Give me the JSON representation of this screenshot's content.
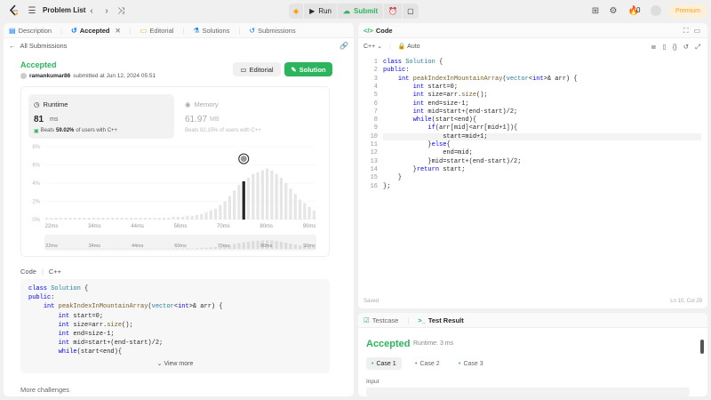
{
  "topbar": {
    "title": "Problem List",
    "run_label": "Run",
    "submit_label": "Submit",
    "fire_count": "0",
    "premium_label": "Premium"
  },
  "left_tabs": [
    {
      "label": "Description",
      "active": false
    },
    {
      "label": "Accepted",
      "active": true
    },
    {
      "label": "Editorial",
      "active": false
    },
    {
      "label": "Solutions",
      "active": false
    },
    {
      "label": "Submissions",
      "active": false
    }
  ],
  "submission": {
    "back_label": "All Submissions",
    "status": "Accepted",
    "user": "ramankumar86",
    "submitted_text": "submitted at Jun 12, 2024 05:51",
    "editorial_label": "Editorial",
    "solution_label": "Solution",
    "runtime_title": "Runtime",
    "runtime_value": "81",
    "runtime_unit": "ms",
    "runtime_beats_prefix": "Beats",
    "runtime_beats": "59.02%",
    "runtime_beats_suffix": "of users with C++",
    "memory_title": "Memory",
    "memory_value": "61.97",
    "memory_unit": "MB",
    "memory_beats_text": "Beats 82.15% of users with C++",
    "code_label": "Code",
    "code_lang": "C++",
    "view_more": "View more",
    "more_challenges": "More challenges"
  },
  "chart_data": {
    "type": "bar",
    "yticks": [
      "8%",
      "6%",
      "4%",
      "2%",
      "0%"
    ],
    "xticks": [
      "22ms",
      "34ms",
      "44ms",
      "56ms",
      "70ms",
      "80ms",
      "90ms"
    ],
    "ylim": [
      0,
      8
    ],
    "values": [
      0.2,
      0.2,
      0.2,
      0.2,
      0.2,
      0.2,
      0.2,
      0.2,
      0.2,
      0.2,
      0.2,
      0.2,
      0.2,
      0.2,
      0.2,
      0.2,
      0.2,
      0.2,
      0.2,
      0.2,
      0.2,
      0.2,
      0.2,
      0.2,
      0.2,
      0.2,
      0.2,
      0.3,
      0.3,
      0.3,
      0.4,
      0.4,
      0.5,
      0.6,
      0.8,
      1.0,
      1.2,
      1.6,
      2.0,
      2.6,
      3.2,
      3.8,
      4.2,
      4.6,
      5.0,
      5.2,
      5.4,
      5.6,
      5.4,
      5.0,
      4.6,
      4.0,
      3.4,
      2.8,
      2.2,
      1.8,
      1.4,
      1.0
    ],
    "highlight_index": 42,
    "highlight_value": 5.6,
    "mini_xticks": [
      "22ms",
      "34ms",
      "44ms",
      "60ms",
      "70ms",
      "80ms",
      "90ms"
    ]
  },
  "left_code": [
    "class Solution {",
    "public:",
    "    int peakIndexInMountainArray(vector<int>& arr) {",
    "        int start=0;",
    "        int size=arr.size();",
    "        int end=size-1;",
    "        int mid=start+(end-start)/2;",
    "        while(start<end){"
  ],
  "editor": {
    "title": "Code",
    "lang": "C++",
    "auto_label": "Auto",
    "saved_label": "Saved",
    "cursor_pos": "Ln 10, Col 29",
    "line_numbers": [
      "1",
      "2",
      "3",
      "4",
      "5",
      "6",
      "7",
      "8",
      "9",
      "10",
      "11",
      "12",
      "13",
      "14",
      "15",
      "16"
    ],
    "lines": [
      "class Solution {",
      "public:",
      "    int peakIndexInMountainArray(vector<int>& arr) {",
      "        int start=0;",
      "        int size=arr.size();",
      "        int end=size-1;",
      "        int mid=start+(end-start)/2;",
      "        while(start<end){",
      "            if(arr[mid]<arr[mid+1]){",
      "                start=mid+1;",
      "            }else{",
      "                end=mid;",
      "            }mid=start+(end-start)/2;",
      "        }return start;",
      "    }",
      "};"
    ]
  },
  "result": {
    "testcase_label": "Testcase",
    "test_result_label": "Test Result",
    "status": "Accepted",
    "runtime": "Runtime: 3 ms",
    "cases": [
      "Case 1",
      "Case 2",
      "Case 3"
    ],
    "input_label": "Input"
  }
}
